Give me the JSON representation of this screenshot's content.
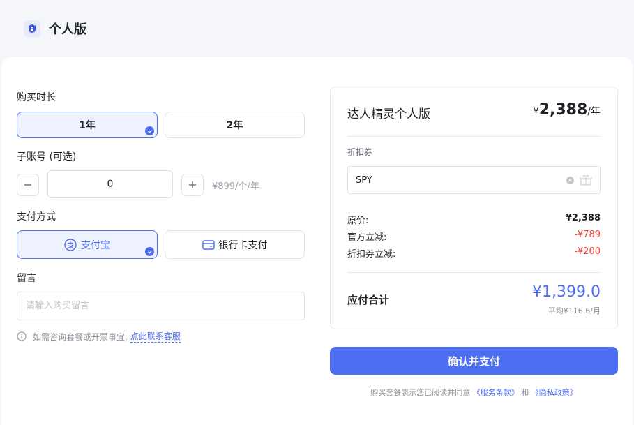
{
  "header": {
    "title": "个人版"
  },
  "purchase": {
    "duration_label": "购买时长",
    "duration_options": [
      "1年",
      "2年"
    ],
    "duration_selected": "1年",
    "subaccount_label": "子账号 (可选)",
    "subaccount_value": "0",
    "subaccount_unit_price": "¥899/个/年",
    "payment_label": "支付方式",
    "payment_options": [
      "支付宝",
      "银行卡支付"
    ],
    "payment_selected": "支付宝",
    "note_label": "留言",
    "note_placeholder": "请输入购买留言",
    "tip_text": "如需咨询套餐或开票事宜,",
    "tip_link": "点此联系客服"
  },
  "summary": {
    "product_name": "达人精灵个人版",
    "price_currency": "¥",
    "price_amount": "2,388",
    "price_period": "/年",
    "coupon_label": "折扣券",
    "coupon_value": "SPY",
    "rows": [
      {
        "label": "原价:",
        "value": "¥2,388"
      },
      {
        "label": "官方立减:",
        "value": "-¥789"
      },
      {
        "label": "折扣券立减:",
        "value": "-¥200"
      }
    ],
    "total_label": "应付合计",
    "total_amount": "¥1,399.0",
    "total_avg": "平均¥116.6/月"
  },
  "actions": {
    "pay_button": "确认并支付",
    "agree_prefix": "购买套餐表示您已阅读并同意",
    "agree_terms": "《服务条款》",
    "agree_and": "和",
    "agree_privacy": "《隐私政策》"
  },
  "colors": {
    "accent": "#4e6ef2",
    "discount": "#f5423b",
    "page_background": "#f4f6fa"
  },
  "icons": [
    "shield-bag-icon",
    "check-icon",
    "minus-icon",
    "plus-icon",
    "alipay-icon",
    "bank-card-icon",
    "info-icon",
    "clear-icon",
    "gift-icon"
  ]
}
